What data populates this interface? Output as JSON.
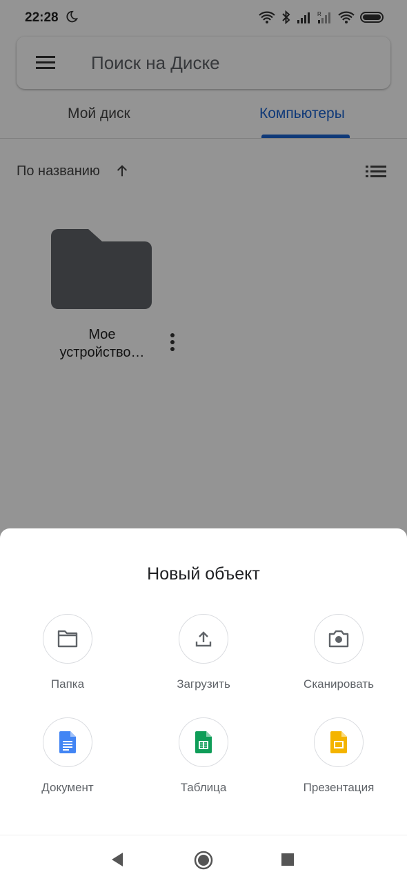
{
  "statusbar": {
    "time": "22:28"
  },
  "search": {
    "placeholder": "Поиск на Диске"
  },
  "tabs": [
    {
      "label": "Мой диск",
      "selected": false
    },
    {
      "label": "Компьютеры",
      "selected": true
    }
  ],
  "sort": {
    "label": "По названию",
    "direction": "ascending"
  },
  "files": [
    {
      "name_line1": "Мое",
      "name_line2": "устройство…",
      "type": "folder"
    }
  ],
  "sheet": {
    "title": "Новый объект",
    "actions": [
      {
        "label": "Папка",
        "icon": "folder-icon"
      },
      {
        "label": "Загрузить",
        "icon": "upload-icon"
      },
      {
        "label": "Сканировать",
        "icon": "camera-icon"
      },
      {
        "label": "Документ",
        "icon": "docs-icon"
      },
      {
        "label": "Таблица",
        "icon": "sheets-icon"
      },
      {
        "label": "Презентация",
        "icon": "slides-icon"
      }
    ]
  },
  "colors": {
    "accent": "#1a62cf",
    "docs": "#4285f4",
    "sheets": "#0f9d58",
    "slides": "#f4b400",
    "folder": "#5f6368"
  }
}
